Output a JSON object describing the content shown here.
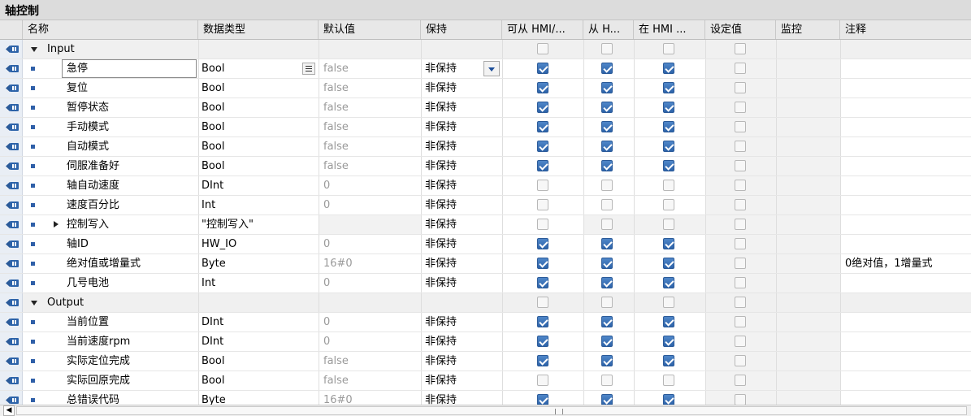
{
  "block_title": "轴控制",
  "columns": {
    "name": "名称",
    "dtype": "数据类型",
    "default": "默认值",
    "retain": "保持",
    "hmi_access": "可从 HMI/...",
    "hmi_write": "从 H...",
    "hmi_visible": "在 HMI ...",
    "setpoint": "设定值",
    "monitor": "监控",
    "comment": "注释"
  },
  "rows": [
    {
      "kind": "group",
      "name": "Input",
      "c1": false,
      "c2": false,
      "c3": false
    },
    {
      "kind": "var",
      "name": "急停",
      "dtype": "Bool",
      "default": "false",
      "retain": "非保持",
      "c1": true,
      "c2": true,
      "c3": true,
      "comment": ""
    },
    {
      "kind": "var",
      "name": "复位",
      "dtype": "Bool",
      "default": "false",
      "retain": "非保持",
      "c1": true,
      "c2": true,
      "c3": true,
      "comment": ""
    },
    {
      "kind": "var",
      "name": "暂停状态",
      "dtype": "Bool",
      "default": "false",
      "retain": "非保持",
      "c1": true,
      "c2": true,
      "c3": true,
      "comment": ""
    },
    {
      "kind": "var",
      "name": "手动模式",
      "dtype": "Bool",
      "default": "false",
      "retain": "非保持",
      "c1": true,
      "c2": true,
      "c3": true,
      "comment": ""
    },
    {
      "kind": "var",
      "name": "自动模式",
      "dtype": "Bool",
      "default": "false",
      "retain": "非保持",
      "c1": true,
      "c2": true,
      "c3": true,
      "comment": ""
    },
    {
      "kind": "var",
      "name": "伺服准备好",
      "dtype": "Bool",
      "default": "false",
      "retain": "非保持",
      "c1": true,
      "c2": true,
      "c3": true,
      "comment": ""
    },
    {
      "kind": "var",
      "name": "轴自动速度",
      "dtype": "DInt",
      "default": "0",
      "retain": "非保持",
      "c1": false,
      "c2": false,
      "c3": false,
      "comment": ""
    },
    {
      "kind": "var",
      "name": "速度百分比",
      "dtype": "Int",
      "default": "0",
      "retain": "非保持",
      "c1": false,
      "c2": false,
      "c3": false,
      "comment": ""
    },
    {
      "kind": "struct",
      "name": "控制写入",
      "dtype": "\"控制写入\"",
      "default": "",
      "retain": "非保持",
      "c1": false,
      "c2": false,
      "c3": false,
      "comment": ""
    },
    {
      "kind": "var",
      "name": "轴ID",
      "dtype": "HW_IO",
      "default": "0",
      "retain": "非保持",
      "c1": true,
      "c2": true,
      "c3": true,
      "comment": ""
    },
    {
      "kind": "var",
      "name": "绝对值或增量式",
      "dtype": "Byte",
      "default": "16#0",
      "retain": "非保持",
      "c1": true,
      "c2": true,
      "c3": true,
      "comment": "0绝对值，1增量式"
    },
    {
      "kind": "var",
      "name": "几号电池",
      "dtype": "Int",
      "default": "0",
      "retain": "非保持",
      "c1": true,
      "c2": true,
      "c3": true,
      "comment": ""
    },
    {
      "kind": "group",
      "name": "Output",
      "c1": false,
      "c2": false,
      "c3": false
    },
    {
      "kind": "var",
      "name": "当前位置",
      "dtype": "DInt",
      "default": "0",
      "retain": "非保持",
      "c1": true,
      "c2": true,
      "c3": true,
      "comment": ""
    },
    {
      "kind": "var",
      "name": "当前速度rpm",
      "dtype": "DInt",
      "default": "0",
      "retain": "非保持",
      "c1": true,
      "c2": true,
      "c3": true,
      "comment": ""
    },
    {
      "kind": "var",
      "name": "实际定位完成",
      "dtype": "Bool",
      "default": "false",
      "retain": "非保持",
      "c1": true,
      "c2": true,
      "c3": true,
      "comment": ""
    },
    {
      "kind": "var",
      "name": "实际回原完成",
      "dtype": "Bool",
      "default": "false",
      "retain": "非保持",
      "c1": false,
      "c2": false,
      "c3": false,
      "comment": ""
    },
    {
      "kind": "var",
      "name": "总错误代码",
      "dtype": "Byte",
      "default": "16#0",
      "retain": "非保持",
      "c1": true,
      "c2": true,
      "c3": true,
      "comment": ""
    }
  ],
  "colors": {
    "accent": "#2d63a9",
    "header_bg": "#e8e8e8",
    "title_bg": "#dcdcdc"
  }
}
